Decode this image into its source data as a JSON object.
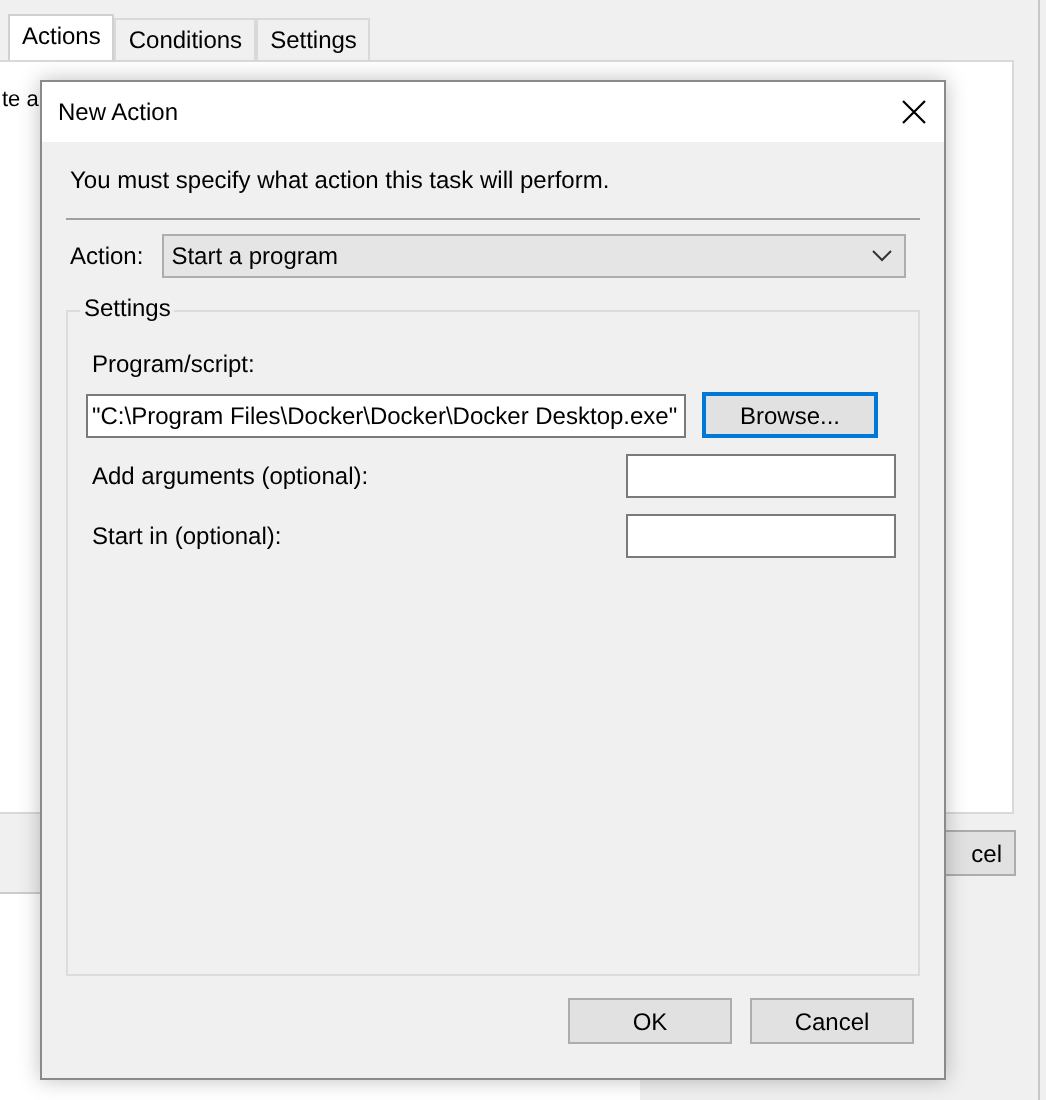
{
  "background_window": {
    "tabs": [
      {
        "label": "Actions",
        "selected": true
      },
      {
        "label": "Conditions",
        "selected": false
      },
      {
        "label": "Settings",
        "selected": false
      }
    ],
    "panel_text": "te a",
    "button": "cel"
  },
  "dialog": {
    "title": "New Action",
    "message": "You must specify what action this task will perform.",
    "action": {
      "label": "Action:",
      "value": "Start a program"
    },
    "settings": {
      "title": "Settings",
      "program_label": "Program/script:",
      "program_value": "\"C:\\Program Files\\Docker\\Docker\\Docker Desktop.exe\"",
      "browse": "Browse...",
      "fields": [
        {
          "label": "Add arguments (optional):"
        },
        {
          "label": "Start in (optional):"
        }
      ]
    },
    "buttons": [
      "OK",
      "Cancel"
    ]
  }
}
